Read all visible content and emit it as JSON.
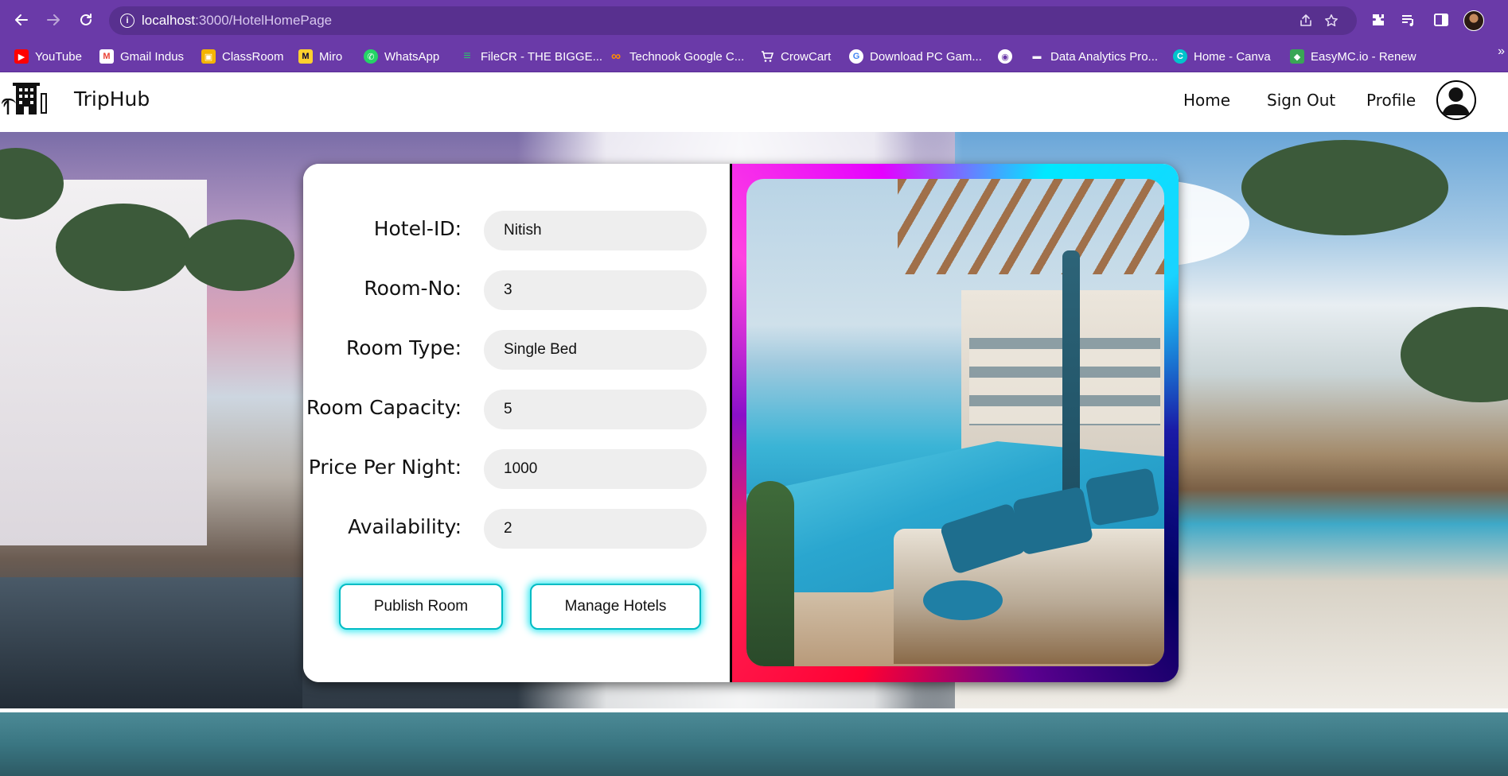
{
  "browser": {
    "url_host": "localhost",
    "url_path": ":3000/HotelHomePage",
    "bookmarks": [
      {
        "label": "YouTube",
        "color": "#ff0000",
        "glyph": "▶"
      },
      {
        "label": "Gmail Indus",
        "color": "#ea4335",
        "glyph": "M"
      },
      {
        "label": "ClassRoom",
        "color": "#f4b400",
        "glyph": "▣"
      },
      {
        "label": "Miro",
        "color": "#ffd02f",
        "glyph": "M"
      },
      {
        "label": "WhatsApp",
        "color": "#25d366",
        "glyph": "✆"
      },
      {
        "label": "FileCR - THE BIGGE...",
        "color": "#2fbf71",
        "glyph": "≡"
      },
      {
        "label": "Technook Google C...",
        "color": "#ff8c00",
        "glyph": "∞"
      },
      {
        "label": "CrowCart",
        "color": "#6a3aa8",
        "glyph": "🛒"
      },
      {
        "label": "Download PC Gam...",
        "color": "#4285f4",
        "glyph": "G"
      },
      {
        "label": "",
        "color": "#6a3aa8",
        "glyph": "◉"
      },
      {
        "label": "Data Analytics Pro...",
        "color": "#333333",
        "glyph": "▬"
      },
      {
        "label": "Home - Canva",
        "color": "#00c4cc",
        "glyph": "C"
      },
      {
        "label": "EasyMC.io - Renew",
        "color": "#3aa655",
        "glyph": "◆"
      }
    ],
    "more_glyph": "»"
  },
  "app": {
    "brand": "TripHub",
    "nav": {
      "home": "Home",
      "sign_out": "Sign Out",
      "profile": "Profile"
    }
  },
  "form": {
    "fields": [
      {
        "label": "Hotel-ID:",
        "value": "Nitish"
      },
      {
        "label": "Room-No:",
        "value": "3"
      },
      {
        "label": "Room Type:",
        "value": "Single Bed"
      },
      {
        "label": "Room Capacity:",
        "value": "5"
      },
      {
        "label": "Price Per Night:",
        "value": "1000"
      },
      {
        "label": "Availability:",
        "value": "2"
      }
    ],
    "publish_label": "Publish Room",
    "manage_label": "Manage Hotels"
  },
  "colors": {
    "chrome": "#6a3aa8",
    "button_glow": "#27e6f0",
    "input_bg": "#eeeeee"
  }
}
